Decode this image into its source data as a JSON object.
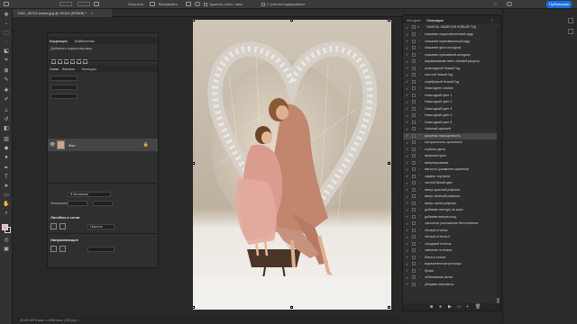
{
  "options_bar": {
    "clear_label": "Очистить",
    "straighten_label": "Выпрямить",
    "delete_cropped_label": "Удалить отсеч. пикс.",
    "content_aware_label": "С учетом содержимого",
    "publish_label": "Публикация"
  },
  "document_tab": {
    "title": "DSC_50722 копия.jpg @ 39,6% (RGB/8) *",
    "close": "×"
  },
  "left_panel": {
    "tabs_top": [
      "Коррекция",
      "Библиотеки"
    ],
    "add_adjustment": "Добавить корректировку",
    "tabs_layers": [
      "Слои",
      "Каналы",
      "Контуры"
    ],
    "layer_name": "Фон",
    "blend_mode": "В биговании",
    "fill_label": "Заполнять",
    "lines_grid_title": "Линейки и сетки",
    "pixels_label": "Пиксели",
    "guides_title": "Направляющие"
  },
  "right_panel": {
    "tabs": [
      "История",
      "Операции"
    ],
    "set_name": "ПАНЕЛЬ ЭКШЕНОВ НОВЫЙ ГОД",
    "actions": [
      "опасание недоосветленный кадр",
      "опасание пересвеченный кадр",
      "опасание фото исходник",
      "опасание оранжевый исходник",
      "выравнивание свето-тёмный рисунок",
      "шоколадный Новый Год",
      "золотой Новый Год",
      "серебряный Новый Год",
      "Новогоднее сияние",
      "Новогодний цвет 1",
      "Новогодний цвет 2",
      "Новогодний цвет 3",
      "Новогодний цвет 4",
      "Новогодний цвет 5",
      "снежный красный",
      "красивая насыщенность",
      "контрастность оригинала",
      "глубина цвета",
      "микроконтраст",
      "виньетирование",
      "мягкость (размытие картинки)",
      "эффект портрета",
      "чистый белый цвет",
      "минус красный рефлекс",
      "минус зелёный рефлекс",
      "минус синий рефлекс",
      "добавим текстуру на кожи",
      "добавим мягкую кожу",
      "частотное разложение без плагинов",
      "тёплый оттенок",
      "тёплый оттенок 2",
      "холодный оттенок",
      "свечение оттенков",
      "блеск в глазах",
      "выразительные ресницы",
      "брови",
      "отбеливание волос",
      "убираем пересветы"
    ],
    "selected_index": 15
  },
  "status_bar": {
    "text": "39,6%    5078 пикс. x 4398 пикс. (300 ppi)    >"
  }
}
